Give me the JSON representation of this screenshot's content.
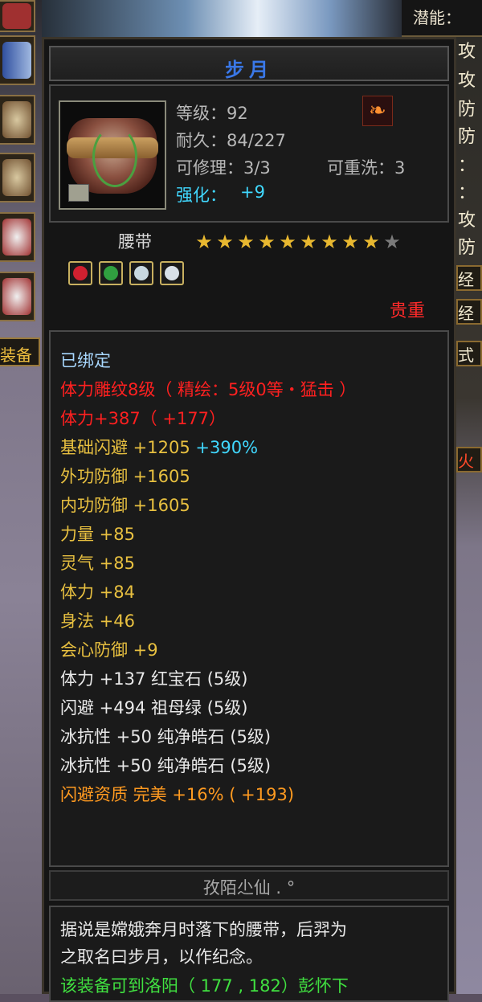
{
  "top_bar": {
    "label": "潜能："
  },
  "right_labels": [
    "攻",
    "攻",
    "防",
    "防",
    "：",
    "：",
    "攻",
    "防"
  ],
  "right_buttons": [
    "经",
    "经",
    "式"
  ],
  "right_fire": "火",
  "equip_tab": "装备",
  "item": {
    "name": "步月",
    "level": "等级：92",
    "durability": "耐久：84/227",
    "repair": "可修理：3/3",
    "reroll": "可重洗：3",
    "enhance_label": "强化：",
    "enhance_value": "+9",
    "type": "腰带",
    "stars_total": 10,
    "stars_lit": 9,
    "quality": "贵重",
    "gems": [
      {
        "color": "#d02030"
      },
      {
        "color": "#30a040"
      },
      {
        "color": "#c8d8e0"
      },
      {
        "color": "#d8e0e8"
      }
    ]
  },
  "attributes": [
    {
      "text": "已绑定",
      "color": "blue"
    },
    {
      "text": "体力雕纹8级（ 精绘：5级0等・猛击 ）",
      "color": "red"
    },
    {
      "text": "体力+387（ +177）",
      "color": "red"
    },
    {
      "text": "基础闪避 +1205",
      "extra": "+390%",
      "color": "gold"
    },
    {
      "text": "外功防御 +1605",
      "color": "gold"
    },
    {
      "text": "内功防御 +1605",
      "color": "gold"
    },
    {
      "text": "力量 +85",
      "color": "gold"
    },
    {
      "text": "灵气 +85",
      "color": "gold"
    },
    {
      "text": "体力 +84",
      "color": "gold"
    },
    {
      "text": "身法 +46",
      "color": "gold"
    },
    {
      "text": "会心防御 +9",
      "color": "gold"
    },
    {
      "text": "体力 +137 红宝石 (5级)",
      "color": "white"
    },
    {
      "text": "闪避 +494 祖母绿 (5级)",
      "color": "white"
    },
    {
      "text": "冰抗性 +50 纯净皓石 (5级)",
      "color": "white"
    },
    {
      "text": "冰抗性 +50 纯净皓石 (5级)",
      "color": "white"
    },
    {
      "text": "闪避资质  完美 +16% ( +193)",
      "color": "orange"
    }
  ],
  "craftsman": "孜陌尐仙 . °",
  "description": {
    "line1": "据说是嫦娥奔月时落下的腰带，后羿为",
    "line2": "之取名曰步月，以作纪念。",
    "line3": "该装备可到洛阳（ 177 , 182）彭怀下"
  },
  "colors": {
    "title": "#3a78e8",
    "gold": "#e8c040",
    "red": "#ff2020",
    "cyan": "#40d8ff"
  }
}
